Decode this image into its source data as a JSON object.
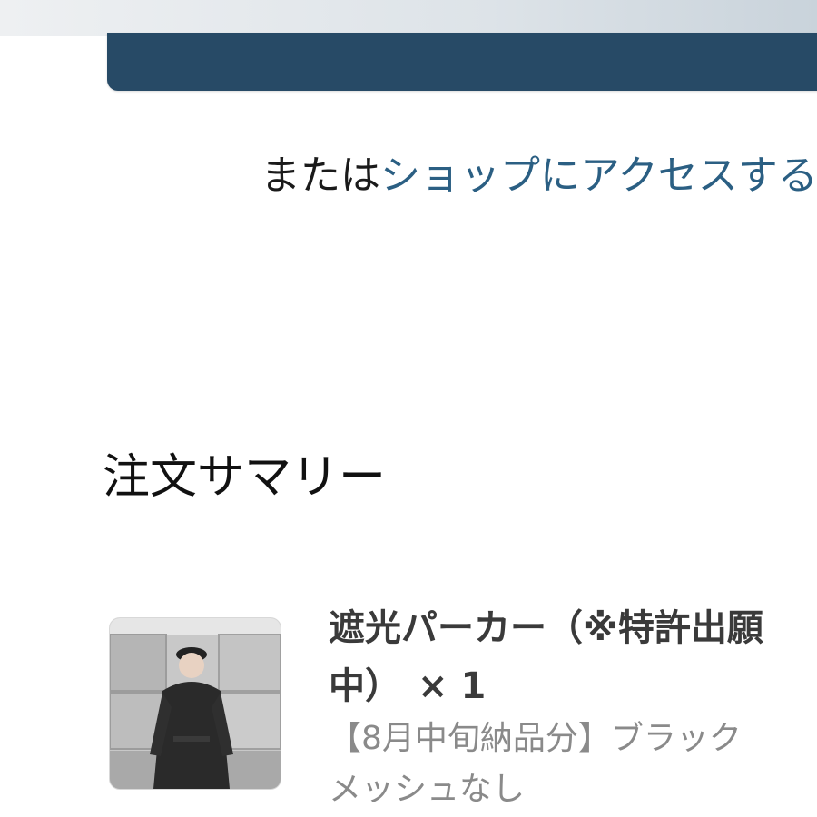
{
  "checkout": {
    "alt_prefix": "または",
    "alt_link": "ショップにアクセスする"
  },
  "order_summary": {
    "title": "注文サマリー",
    "items": [
      {
        "name": "遮光パーカー（※特許出願中）",
        "quantity": "× 1",
        "variant": "【8月中旬納品分】ブラックメッシュなし",
        "thumbnail_icon": "product-photo"
      }
    ]
  },
  "colors": {
    "primary_button": "#274a66",
    "link": "#2b5f83",
    "variant_text": "#8a8a8a"
  }
}
